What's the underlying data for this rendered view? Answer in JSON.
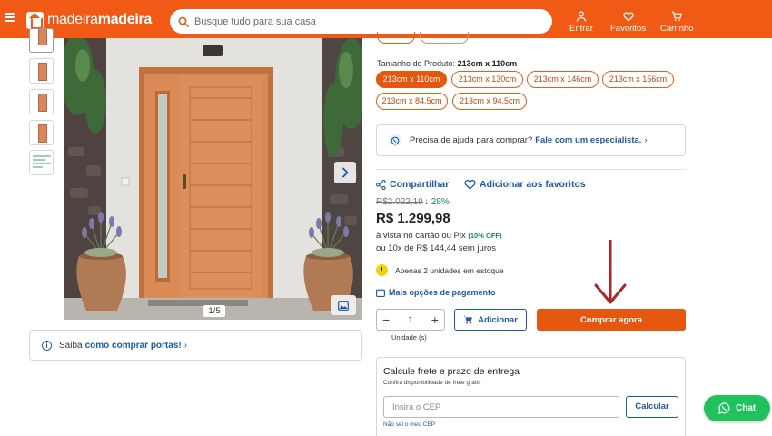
{
  "header": {
    "logo": {
      "part1": "madeira",
      "part2": "madeira"
    },
    "search": {
      "placeholder": "Busque tudo para sua casa"
    },
    "actions": [
      {
        "label": "Entrar",
        "icon": "user-icon"
      },
      {
        "label": "Favoritos",
        "icon": "heart-icon"
      },
      {
        "label": "Carrinho",
        "icon": "cart-icon"
      }
    ],
    "color": "#f05a14"
  },
  "gallery": {
    "thumbnails": [
      "door-front",
      "door-front",
      "door-front",
      "door-front",
      "spec-sheet"
    ],
    "counter": "1/5"
  },
  "howto": {
    "prefix": "Saiba",
    "link": "como comprar portas!",
    "chevron": "›"
  },
  "product": {
    "size_label": "Tamanho do Produto:",
    "size_value": "213cm x 110cm",
    "sizes": [
      "213cm x 110cm",
      "213cm x 130cm",
      "213cm x 146cm",
      "213cm x 156cm",
      "213cm x 84,5cm",
      "213cm x 94,5cm"
    ],
    "selected_size": "213cm x 110cm"
  },
  "help": {
    "text": "Precisa de ajuda para comprar?",
    "link": "Fale com um especialista.",
    "chevron": "›"
  },
  "social": {
    "share": "Compartilhar",
    "favorite": "Adicionar aos favoritos"
  },
  "pricing": {
    "old_price": "R$2.022,19",
    "discount": "28%",
    "price": "R$ 1.299,98",
    "cash_text": "à vista no cartão ou Pix",
    "cash_discount": "(10% OFF)",
    "installments": "ou 10x de R$ 144,44 sem juros"
  },
  "stock": {
    "icon": "warning-icon",
    "text": "Apenas 2 unidades em estoque"
  },
  "payment": {
    "link": "Mais opções de pagamento"
  },
  "cart": {
    "quantity": "1",
    "minus": "−",
    "plus": "+",
    "unit_label": "Unidade (s)",
    "add_label": "Adicionar",
    "buy_label": "Comprar agora"
  },
  "shipping": {
    "title": "Calcule frete e prazo de entrega",
    "subtitle": "Confira disponibilidade de frete grátis",
    "cep_placeholder": "Insira o CEP",
    "calc_label": "Calcular",
    "no_cep": "Não sei o meu CEP"
  },
  "chat": {
    "label": "Chat"
  },
  "colors": {
    "accent": "#e5560f",
    "link": "#1c5aa8",
    "success": "#1a8a5a",
    "whatsapp": "#21c25e",
    "annotation_arrow": "#a72828"
  }
}
